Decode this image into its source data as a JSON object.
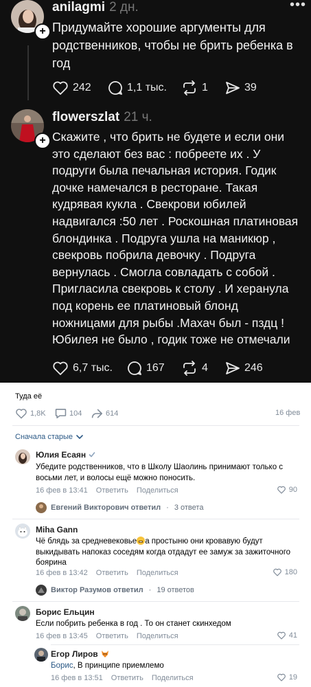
{
  "threads_posts": [
    {
      "username": "anilagmi",
      "time": "2 дн.",
      "text": "Придумайте хорошие аргументы для родственников, чтобы не брить ребенка в год",
      "likes": "242",
      "replies": "1,1 тыс.",
      "reposts": "1",
      "shares": "39"
    },
    {
      "username": "flowerszlat",
      "time": "21 ч.",
      "text": "Скажите , что брить не будете и если они это сделают без вас : побреете их . У подруги была печальная история. Годик дочке намечался в ресторане. Такая кудрявая кукла . Свекрови юбилей надвигался :50 лет . Роскошная платиновая блондинка . Подруга ушла на маникюр , свекровь побрила девочку . Подруга вернулась . Смогла совладать с собой . Пригласила свекровь к столу . И херанула под корень ее платиновый блонд ножницами для рыбы .Махач был - пздц ! Юбилея не было , годик тоже не отмечали",
      "likes": "6,7 тыс.",
      "replies": "167",
      "reposts": "4",
      "shares": "246"
    }
  ],
  "vk_post": {
    "caption": "Туда её",
    "likes": "1,8K",
    "comments": "104",
    "shares": "614",
    "date": "16 фев"
  },
  "sort_label": "Сначала старые",
  "labels": {
    "reply": "Ответить",
    "share": "Поделиться"
  },
  "comments": [
    {
      "name": "Юлия Есаян",
      "text": "Убедите родственников, что в Школу Шаолинь принимают только с восьми лет, и волосы ещё можно поносить.",
      "date": "16 фев в 13:41",
      "likes": "90",
      "thread": {
        "author": "Евгений Викторович",
        "action": "ответил",
        "count": "3 ответа"
      }
    },
    {
      "name": "Miha Gann",
      "text_a": "Чё блядь за средневековье",
      "text_b": "а простыню они кровавую будут выкидывать напоказ соседям когда отдадут ее замуж за зажиточного боярина",
      "date": "16 фев в 13:42",
      "likes": "180",
      "thread": {
        "author": "Виктор Разумов",
        "action": "ответил",
        "count": "19 ответов"
      }
    },
    {
      "name": "Борис Ельцин",
      "text": "Если побрить ребенка в год . То он станет скинхедом",
      "date": "16 фев в 13:45",
      "likes": "41"
    }
  ],
  "reply": {
    "name": "Егор Лиров",
    "mention": "Борис",
    "text": ", В принципе приемлемо",
    "date": "16 фев в 13:51",
    "likes": "19"
  }
}
